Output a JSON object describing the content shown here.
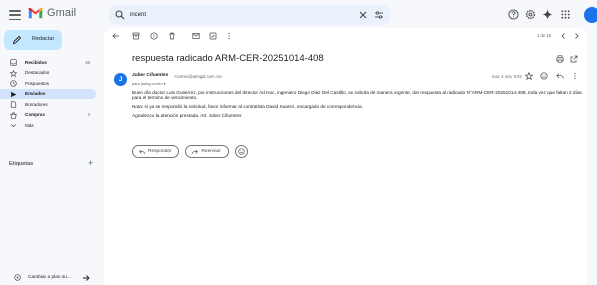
{
  "header": {
    "app_name": "Gmail",
    "search": {
      "value": "incent"
    }
  },
  "sidebar": {
    "compose_label": "Redactar",
    "items": [
      {
        "label": "Recibidos",
        "count": "46",
        "bold": true,
        "active": false,
        "icon": "inbox-icon"
      },
      {
        "label": "Destacados",
        "count": "",
        "bold": false,
        "active": false,
        "icon": "star-icon"
      },
      {
        "label": "Pospuestos",
        "count": "",
        "bold": false,
        "active": false,
        "icon": "clock-icon"
      },
      {
        "label": "Enviados",
        "count": "",
        "bold": true,
        "active": true,
        "icon": "send-icon"
      },
      {
        "label": "Borradores",
        "count": "",
        "bold": false,
        "active": false,
        "icon": "draft-icon"
      },
      {
        "label": "Compras",
        "count": "4",
        "bold": true,
        "active": false,
        "icon": "shopping-icon"
      },
      {
        "label": "Más",
        "count": "",
        "bold": false,
        "active": false,
        "icon": "chevron-down-icon"
      }
    ],
    "labels_title": "Etiquetas",
    "labels_add": "+",
    "switch_label": "Cambiar a plan su..."
  },
  "toolbar": {
    "pager": "1 de 16"
  },
  "email": {
    "subject": "respuesta radicado ARM-CER-20251014-408",
    "sender_initial": "J",
    "sender_name": "Juber Cifuentes",
    "sender_email": "<correo@armgid.com.co>",
    "to_line": "para juang.correo ▾",
    "date": "mar, 4 nov, 9:02",
    "body": [
      "Buen día doctor Luis Gutierrez, por instrucciones del director Ad Hoc, ingeniero Diego Diaz Del Castillo, se solicita de manera urgente, dar respuesta al radicado N°ARM-CER-20251014-408, toda vez que faltan 2 días para el termino de vencimiento.",
      "Nota: si ya se respondió la solicitud, favor informar al contratista David Suarez, encargado de correspondencia.",
      "Agradezco la atención prestada. Att. Juber Cifuentes"
    ]
  },
  "actions": {
    "reply": "Responder",
    "forward": "Reenviar"
  },
  "colors": {
    "accent": "#1a73e8",
    "compose_bg": "#c2e7ff",
    "active_nav_bg": "#d3e3fd",
    "search_bg": "#eaf1fb",
    "app_bg": "#f6f8fc"
  }
}
